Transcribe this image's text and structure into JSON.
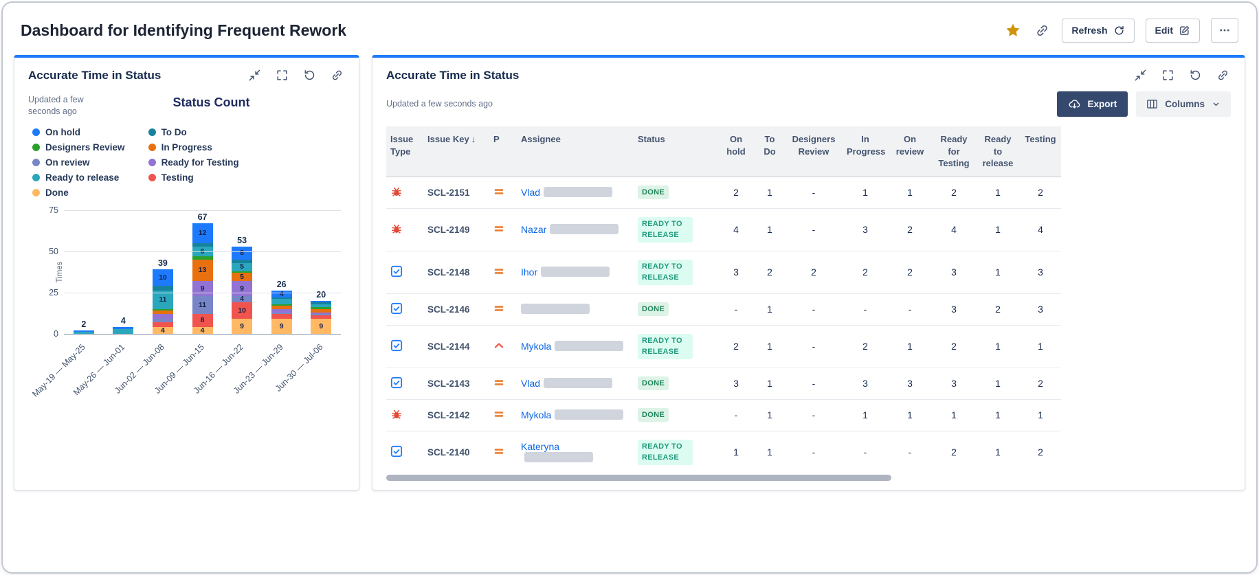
{
  "theme": {
    "panel_accent": "#1d7afc",
    "link_color": "#0c66e4",
    "done_bg": "#dcf3e6",
    "done_fg": "#1f845a",
    "ready_bg": "#dcfcf1",
    "ready_fg": "#1f9a7c"
  },
  "header": {
    "title": "Dashboard for Identifying Frequent Rework",
    "refresh_label": "Refresh",
    "edit_label": "Edit"
  },
  "left_panel": {
    "title": "Accurate Time in Status",
    "updated": "Updated a few seconds ago"
  },
  "right_panel": {
    "title": "Accurate Time in Status",
    "updated": "Updated a few seconds ago",
    "export_label": "Export",
    "columns_label": "Columns"
  },
  "chart_data": {
    "type": "bar",
    "stacked": true,
    "title": "Status Count",
    "ylabel": "Times",
    "ylim": [
      0,
      75
    ],
    "yticks": [
      0,
      25,
      50,
      75
    ],
    "categories": [
      "May-19 — May-25",
      "May-26 — Jun-01",
      "Jun-02 — Jun-08",
      "Jun-09 — Jun-15",
      "Jun-16 — Jun-22",
      "Jun-23 — Jun-29",
      "Jun-30 — Jul-06"
    ],
    "totals": [
      2,
      4,
      39,
      67,
      53,
      26,
      20
    ],
    "legend_columns": [
      [
        "On hold",
        "Designers Review",
        "On review",
        "Ready to release",
        "Done"
      ],
      [
        "To Do",
        "In Progress",
        "Ready for Testing",
        "Testing"
      ]
    ],
    "series": [
      {
        "name": "Done",
        "color": "#ffb864",
        "values": [
          0,
          0,
          4,
          4,
          9,
          9,
          9
        ]
      },
      {
        "name": "Testing",
        "color": "#f0544f",
        "values": [
          0,
          0,
          3,
          8,
          10,
          3,
          2
        ]
      },
      {
        "name": "On review",
        "color": "#7886c7",
        "values": [
          0,
          0,
          2,
          11,
          4,
          1,
          1
        ]
      },
      {
        "name": "Ready for Testing",
        "color": "#9273d4",
        "values": [
          0,
          0,
          3,
          9,
          9,
          2,
          1
        ]
      },
      {
        "name": "In Progress",
        "color": "#e8700e",
        "values": [
          0,
          0,
          2,
          13,
          5,
          2,
          2
        ]
      },
      {
        "name": "Designers Review",
        "color": "#2ca02c",
        "values": [
          0,
          0,
          1,
          2,
          1,
          1,
          1
        ]
      },
      {
        "name": "Ready to release",
        "color": "#2aa7bd",
        "values": [
          1,
          3,
          11,
          6,
          5,
          3,
          2
        ]
      },
      {
        "name": "To Do",
        "color": "#17829e",
        "values": [
          0,
          0,
          3,
          2,
          2,
          1,
          1
        ]
      },
      {
        "name": "On hold",
        "color": "#1d7afc",
        "values": [
          1,
          1,
          10,
          12,
          8,
          4,
          1
        ]
      }
    ]
  },
  "table": {
    "sorted_by": "Issue Key",
    "sort_indicator": "↓",
    "columns": [
      {
        "label": "Issue Type",
        "type": "text"
      },
      {
        "label": "Issue Key",
        "type": "text"
      },
      {
        "label": "P",
        "type": "text"
      },
      {
        "label": "Assignee",
        "type": "text"
      },
      {
        "label": "Status",
        "type": "text"
      },
      {
        "label": "On hold",
        "type": "num"
      },
      {
        "label": "To Do",
        "type": "num"
      },
      {
        "label": "Designers Review",
        "type": "num"
      },
      {
        "label": "In Progress",
        "type": "num"
      },
      {
        "label": "On review",
        "type": "num"
      },
      {
        "label": "Ready for Testing",
        "type": "num"
      },
      {
        "label": "Ready to release",
        "type": "num"
      },
      {
        "label": "Testing",
        "type": "num"
      }
    ],
    "rows": [
      {
        "issue_type": "bug",
        "key": "SCL-2151",
        "priority": "medium",
        "assignee": "Vlad",
        "status": "DONE",
        "status_kind": "done",
        "values": [
          "2",
          "1",
          "-",
          "1",
          "1",
          "2",
          "1",
          "2"
        ]
      },
      {
        "issue_type": "bug",
        "key": "SCL-2149",
        "priority": "medium",
        "assignee": "Nazar",
        "status": "READY TO RELEASE",
        "status_kind": "ready",
        "values": [
          "4",
          "1",
          "-",
          "3",
          "2",
          "4",
          "1",
          "4"
        ]
      },
      {
        "issue_type": "task",
        "key": "SCL-2148",
        "priority": "medium",
        "assignee": "Ihor",
        "status": "READY TO RELEASE",
        "status_kind": "ready",
        "values": [
          "3",
          "2",
          "2",
          "2",
          "2",
          "3",
          "1",
          "3"
        ]
      },
      {
        "issue_type": "task",
        "key": "SCL-2146",
        "priority": "medium",
        "assignee": "",
        "status": "DONE",
        "status_kind": "done",
        "values": [
          "-",
          "1",
          "-",
          "-",
          "-",
          "3",
          "2",
          "3"
        ]
      },
      {
        "issue_type": "task",
        "key": "SCL-2144",
        "priority": "high",
        "assignee": "Mykola",
        "status": "READY TO RELEASE",
        "status_kind": "ready",
        "values": [
          "2",
          "1",
          "-",
          "2",
          "1",
          "2",
          "1",
          "1"
        ]
      },
      {
        "issue_type": "task",
        "key": "SCL-2143",
        "priority": "medium",
        "assignee": "Vlad",
        "status": "DONE",
        "status_kind": "done",
        "values": [
          "3",
          "1",
          "-",
          "3",
          "3",
          "3",
          "1",
          "2"
        ]
      },
      {
        "issue_type": "bug",
        "key": "SCL-2142",
        "priority": "medium",
        "assignee": "Mykola",
        "status": "DONE",
        "status_kind": "done",
        "values": [
          "-",
          "1",
          "-",
          "1",
          "1",
          "1",
          "1",
          "1"
        ]
      },
      {
        "issue_type": "task",
        "key": "SCL-2140",
        "priority": "medium",
        "assignee": "Kateryna",
        "status": "READY TO RELEASE",
        "status_kind": "ready",
        "values": [
          "1",
          "1",
          "-",
          "-",
          "-",
          "2",
          "1",
          "2"
        ]
      }
    ]
  }
}
